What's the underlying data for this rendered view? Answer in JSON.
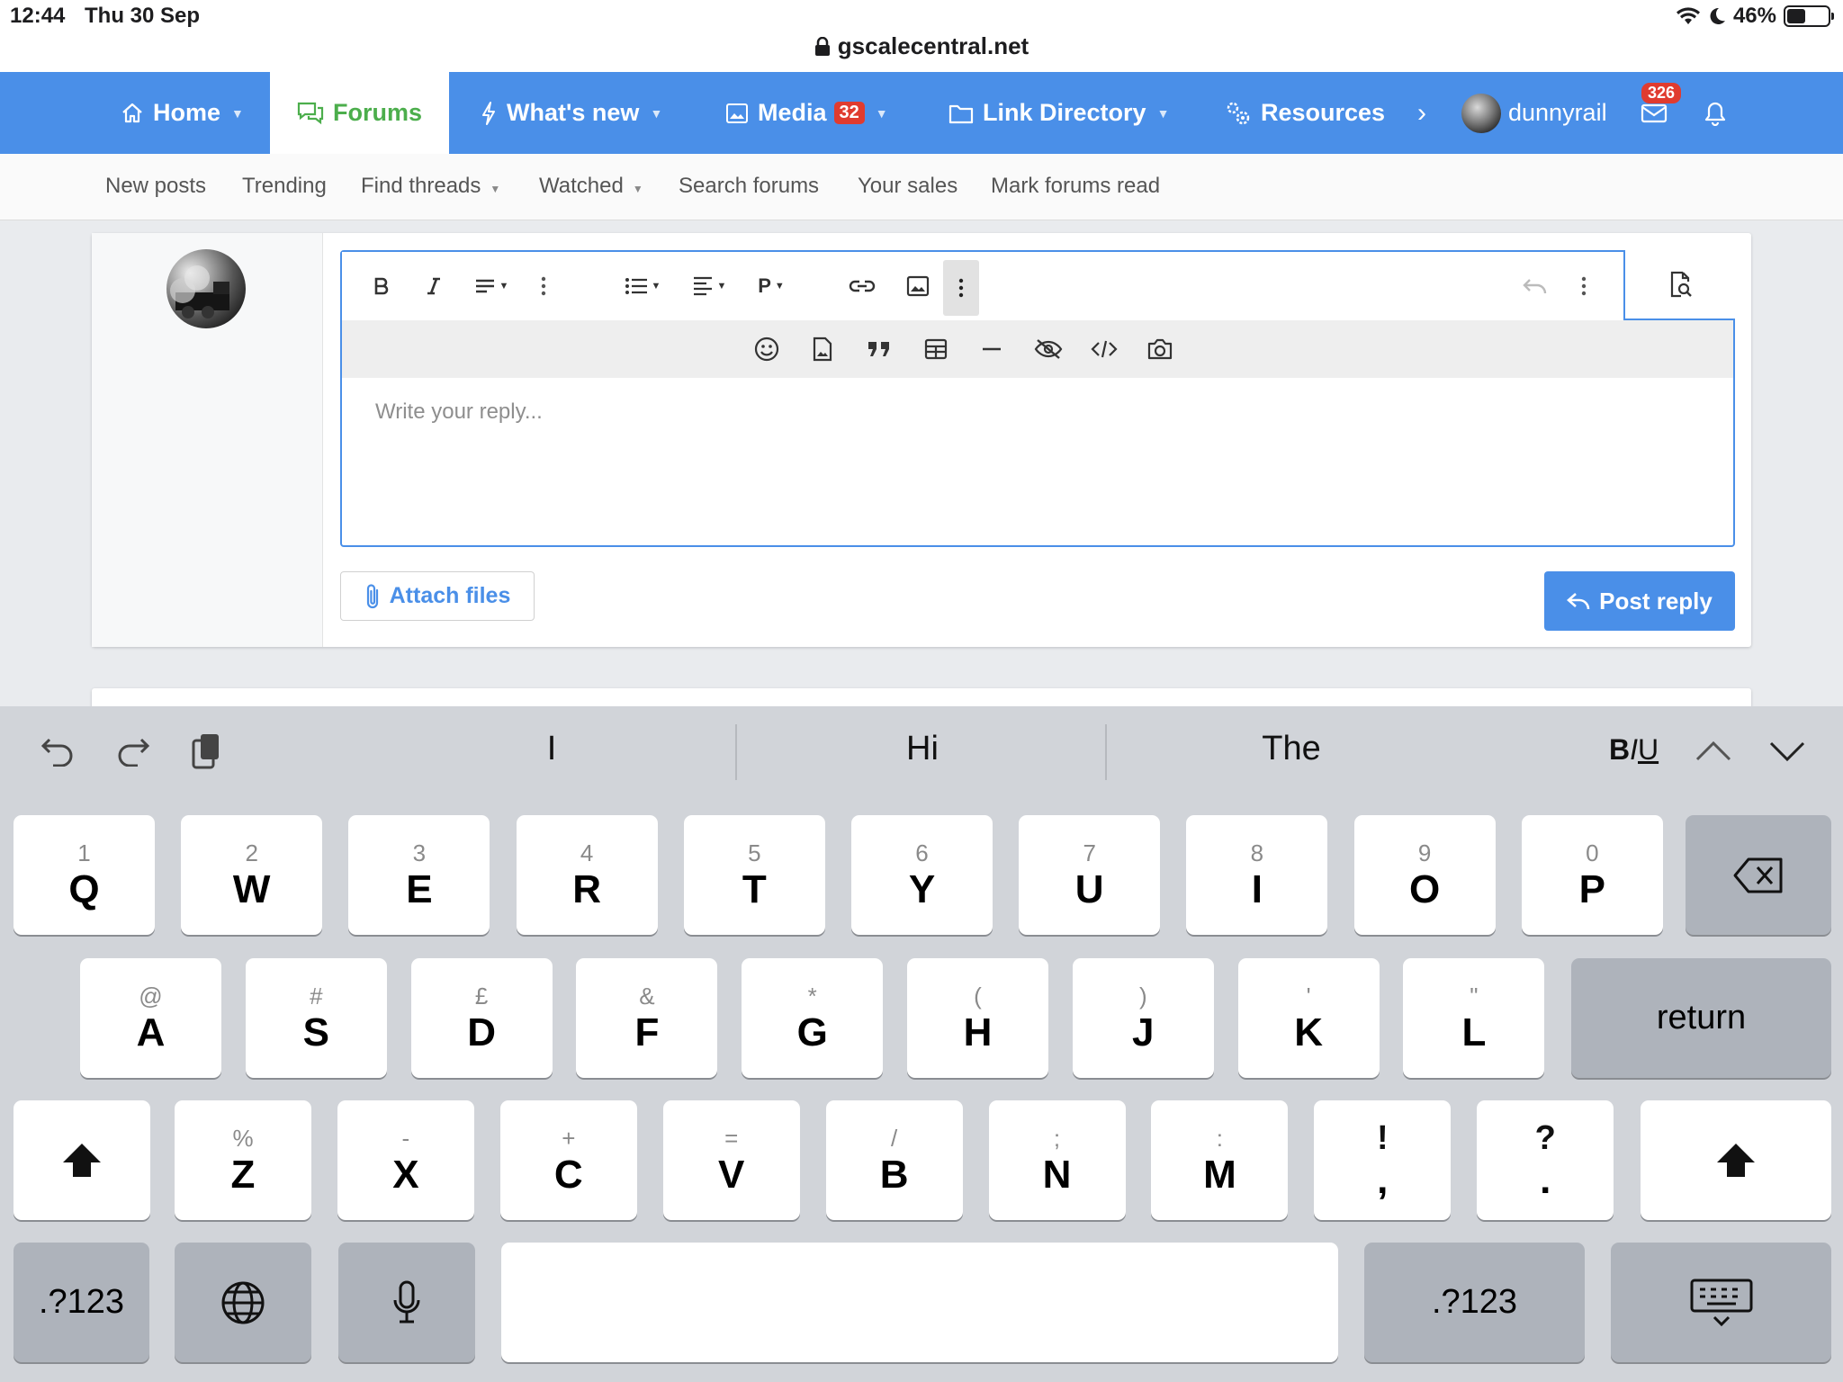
{
  "status_bar": {
    "time": "12:44",
    "date": "Thu 30 Sep",
    "url": "gscalecentral.net",
    "battery": "46%",
    "battery_level": 0.46
  },
  "nav": {
    "home": "Home",
    "forums": "Forums",
    "whats_new": "What's new",
    "media": "Media",
    "media_badge": "32",
    "link_directory": "Link Directory",
    "resources": "Resources",
    "username": "dunnyrail",
    "mail_badge": "326"
  },
  "subnav": {
    "new_posts": "New posts",
    "trending": "Trending",
    "find_threads": "Find threads",
    "watched": "Watched",
    "search_forums": "Search forums",
    "your_sales": "Your sales",
    "mark_forums_read": "Mark forums read"
  },
  "editor": {
    "placeholder": "Write your reply...",
    "paragraph_label": "P",
    "attach_files": "Attach files",
    "post_reply": "Post reply"
  },
  "keyboard": {
    "suggestions": [
      "I",
      "Hi",
      "The"
    ],
    "biu": "BIU",
    "row1": [
      {
        "sub": "1",
        "main": "Q"
      },
      {
        "sub": "2",
        "main": "W"
      },
      {
        "sub": "3",
        "main": "E"
      },
      {
        "sub": "4",
        "main": "R"
      },
      {
        "sub": "5",
        "main": "T"
      },
      {
        "sub": "6",
        "main": "Y"
      },
      {
        "sub": "7",
        "main": "U"
      },
      {
        "sub": "8",
        "main": "I"
      },
      {
        "sub": "9",
        "main": "O"
      },
      {
        "sub": "0",
        "main": "P"
      }
    ],
    "row2": [
      {
        "sub": "@",
        "main": "A"
      },
      {
        "sub": "#",
        "main": "S"
      },
      {
        "sub": "£",
        "main": "D"
      },
      {
        "sub": "&",
        "main": "F"
      },
      {
        "sub": "*",
        "main": "G"
      },
      {
        "sub": "(",
        "main": "H"
      },
      {
        "sub": ")",
        "main": "J"
      },
      {
        "sub": "'",
        "main": "K"
      },
      {
        "sub": "\"",
        "main": "L"
      }
    ],
    "row3": [
      {
        "sub": "%",
        "main": "Z"
      },
      {
        "sub": "-",
        "main": "X"
      },
      {
        "sub": "+",
        "main": "C"
      },
      {
        "sub": "=",
        "main": "V"
      },
      {
        "sub": "/",
        "main": "B"
      },
      {
        "sub": ";",
        "main": "N"
      },
      {
        "sub": ":",
        "main": "M"
      },
      {
        "sub": "!",
        "main": ","
      },
      {
        "sub": "?",
        "main": "."
      }
    ],
    "return": "return",
    "numbers": ".?123"
  },
  "colors": {
    "accent": "#4a8fe8",
    "forum_green": "#4cae4c",
    "badge_red": "#e03b2f"
  }
}
